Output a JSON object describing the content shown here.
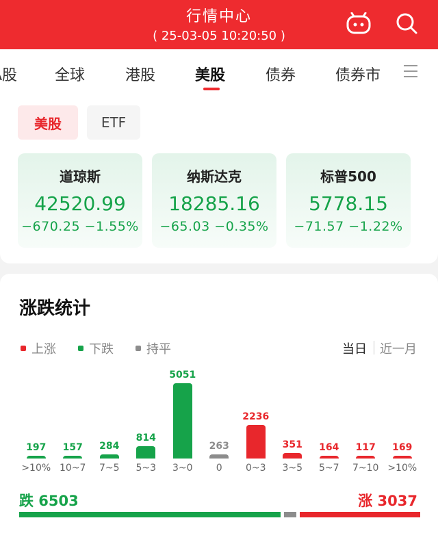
{
  "header": {
    "title": "行情中心",
    "datetime": "( 25-03-05  10:20:50 )"
  },
  "tabs": [
    "A股",
    "全球",
    "港股",
    "美股",
    "债券",
    "债券市"
  ],
  "active_tab": "美股",
  "segments": {
    "us": "美股",
    "etf": "ETF"
  },
  "indices": [
    {
      "name": "道琼斯",
      "value": "42520.99",
      "change": "−670.25  −1.55%"
    },
    {
      "name": "纳斯达克",
      "value": "18285.16",
      "change": "−65.03  −0.35%"
    },
    {
      "name": "标普500",
      "value": "5778.15",
      "change": "−71.57  −1.22%"
    }
  ],
  "stats": {
    "title": "涨跌统计",
    "legend": {
      "up": "上涨",
      "down": "下跌",
      "flat": "持平"
    },
    "range": {
      "today": "当日",
      "month": "近一月"
    },
    "summary": {
      "down": "跌 6503",
      "up": "涨 3037"
    }
  },
  "colors": {
    "up": "#e8272c",
    "down": "#16a34a",
    "flat": "#8c8c8c",
    "brand": "#ee2b2f"
  },
  "chart_data": {
    "type": "bar",
    "categories": [
      ">10%",
      "10~7",
      "7~5",
      "5~3",
      "3~0",
      "0",
      "0~3",
      "3~5",
      "5~7",
      "7~10",
      ">10%"
    ],
    "values": [
      197,
      157,
      284,
      814,
      5051,
      263,
      2236,
      351,
      164,
      117,
      169
    ],
    "groups": [
      "down",
      "down",
      "down",
      "down",
      "down",
      "flat",
      "up",
      "up",
      "up",
      "up",
      "up"
    ],
    "title": "涨跌统计",
    "ratio": {
      "down": 6503,
      "flat": 263,
      "up": 3037
    }
  }
}
